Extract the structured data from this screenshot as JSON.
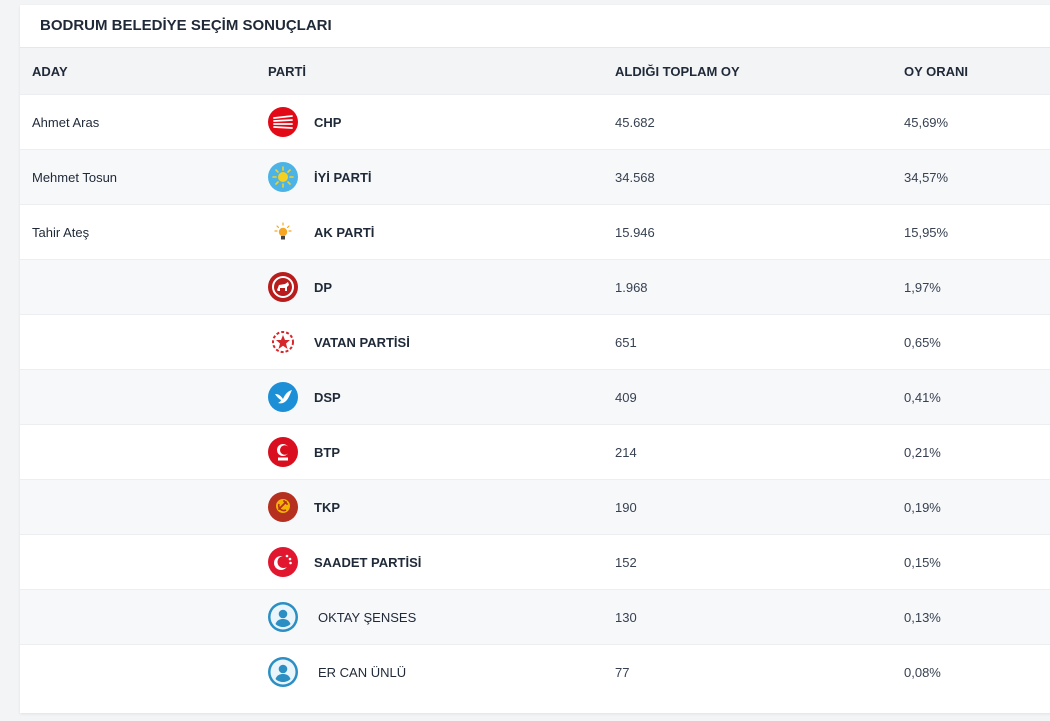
{
  "card": {
    "title": "BODRUM BELEDİYE SEÇİM SONUÇLARI"
  },
  "table": {
    "headers": {
      "aday": "ADAY",
      "parti": "PARTİ",
      "oy": "ALDIĞI TOPLAM OY",
      "oran": "OY ORANI"
    },
    "rows": [
      {
        "aday": "Ahmet Aras",
        "parti": "CHP",
        "oy": "45.682",
        "oran": "45,69%",
        "icon": "chp-six-arrows-icon"
      },
      {
        "aday": "Mehmet Tosun",
        "parti": "İYİ PARTİ",
        "oy": "34.568",
        "oran": "34,57%",
        "icon": "iyi-parti-sun-icon"
      },
      {
        "aday": "Tahir Ateş",
        "parti": "AK PARTİ",
        "oy": "15.946",
        "oran": "15,95%",
        "icon": "ak-parti-bulb-icon"
      },
      {
        "aday": "",
        "parti": "DP",
        "oy": "1.968",
        "oran": "1,97%",
        "icon": "dp-horse-icon"
      },
      {
        "aday": "",
        "parti": "VATAN PARTİSİ",
        "oy": "651",
        "oran": "0,65%",
        "icon": "vatan-star-icon"
      },
      {
        "aday": "",
        "parti": "DSP",
        "oy": "409",
        "oran": "0,41%",
        "icon": "dsp-dove-icon"
      },
      {
        "aday": "",
        "parti": "BTP",
        "oy": "214",
        "oran": "0,21%",
        "icon": "btp-crescent-icon"
      },
      {
        "aday": "",
        "parti": "TKP",
        "oy": "190",
        "oran": "0,19%",
        "icon": "tkp-hammer-sickle-icon"
      },
      {
        "aday": "",
        "parti": "SAADET PARTİSİ",
        "oy": "152",
        "oran": "0,15%",
        "icon": "saadet-crescent-stars-icon"
      },
      {
        "aday": "",
        "parti": "OKTAY ŞENSES",
        "oy": "130",
        "oran": "0,13%",
        "icon": "independent-person-icon"
      },
      {
        "aday": "",
        "parti": "ER CAN ÜNLÜ",
        "oy": "77",
        "oran": "0,08%",
        "icon": "independent-person-icon"
      }
    ]
  },
  "colors": {
    "chp": "#e30a17",
    "iyi": "#4cb3e6",
    "ak": "#f5a623",
    "dp": "#b91c1c",
    "vatan": "#d7262a",
    "dsp": "#1d8fd6",
    "btp": "#d90f1f",
    "tkp": "#b5301f",
    "saadet": "#e1172f",
    "independent": "#2b8fc4"
  }
}
